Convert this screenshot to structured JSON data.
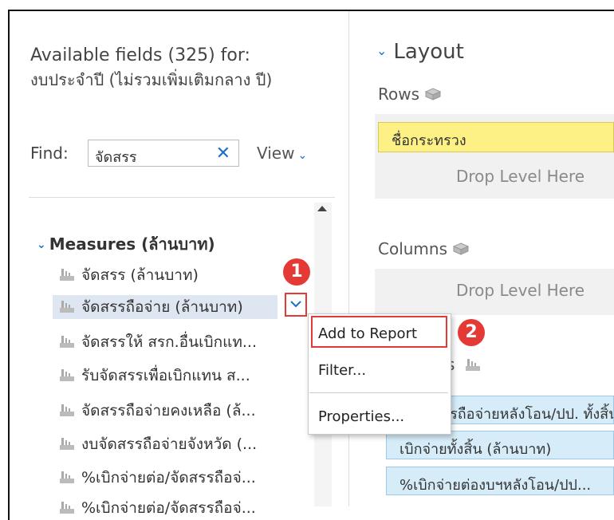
{
  "left_panel": {
    "title": "Available fields (325) for:",
    "subtitle": "งบประจำปี (ไม่รวมเพิ่มเติมกลาง ปี)",
    "find": {
      "label": "Find:",
      "value": "จัดสรร"
    },
    "view_label": "View",
    "tree": {
      "group_label": "Measures (ล้านบาท)",
      "fields": [
        "จัดสรร (ล้านบาท)",
        "จัดสรรถือจ่าย (ล้านบาท)",
        "จัดสรรให้ สรก.อื่นเบิกแท...",
        "รับจัดสรรเพื่อเบิกแทน ส...",
        "จัดสรรถือจ่ายคงเหลือ (ล้...",
        "งบจัดสรรถือจ่ายจังหวัด (...",
        "%เบิกจ่ายต่อ/จัดสรรถือจ่...",
        "%เบิกจ่ายต่อ/จัดสรรถือจ่..."
      ]
    }
  },
  "context_menu": {
    "items": [
      "Add to Report",
      "Filter...",
      "Properties..."
    ]
  },
  "badges": [
    "1",
    "2"
  ],
  "right_panel": {
    "layout_title": "Layout",
    "rows": {
      "label": "Rows",
      "chip": "ชื่อกระทรวง",
      "drop_text": "Drop Level Here"
    },
    "columns": {
      "label": "Columns",
      "drop_text": "Drop Level Here"
    },
    "measures_partial_label": "s",
    "measure_chips": [
      "งบจัดสรรถือจ่ายหลังโอน/ปป. ทั้งสิ้น (ล้า...",
      "เบิกจ่ายทั้งสิ้น (ล้านบาท)",
      "%เบิกจ่ายต่องบฯหลังโอน/ปป..."
    ]
  },
  "colors": {
    "accent": "#1a6fc6",
    "annotation_red": "#e53935",
    "row_chip_yellow": "#fdf186",
    "measure_chip_blue": "#d6ecf8",
    "selected_row": "#dde6f1"
  }
}
